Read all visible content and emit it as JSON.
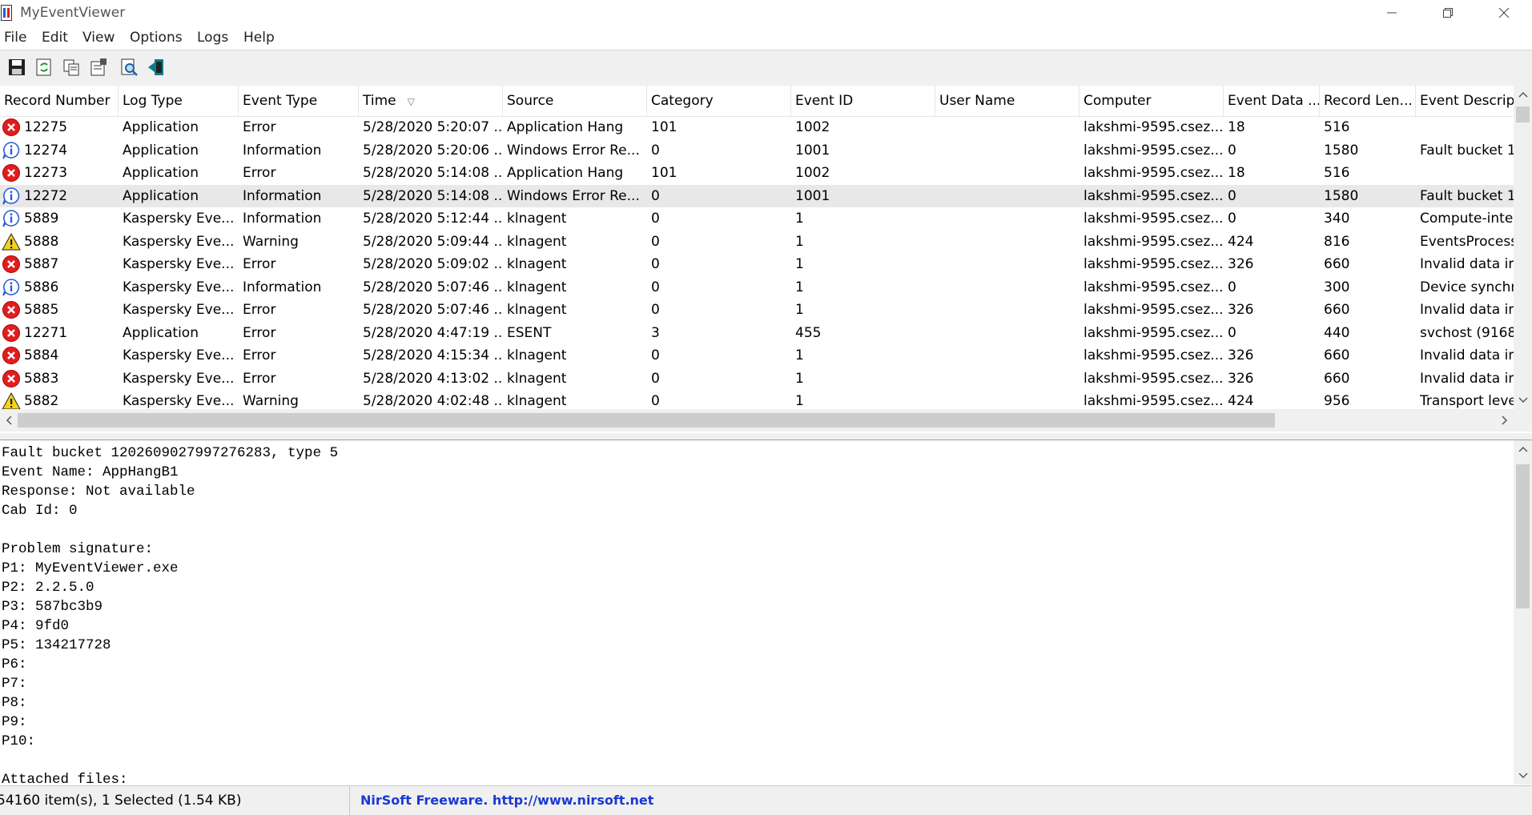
{
  "window": {
    "title": "MyEventViewer",
    "controls": {
      "minimize": "—",
      "maximize": "❐",
      "close": "✕"
    }
  },
  "menu": [
    "File",
    "Edit",
    "View",
    "Options",
    "Logs",
    "Help"
  ],
  "toolbar": {
    "buttons": [
      "save-icon",
      "refresh-icon",
      "copy-icon",
      "properties-icon",
      "find-icon",
      "exit-icon"
    ]
  },
  "list": {
    "columns": [
      "Record Number",
      "Log Type",
      "Event Type",
      "Time",
      "Source",
      "Category",
      "Event ID",
      "User Name",
      "Computer",
      "Event Data ...",
      "Record Len...",
      "Event Descript"
    ],
    "sort_indicator": "▽",
    "rows": [
      {
        "icon": "error",
        "cells": [
          "12275",
          "Application",
          "Error",
          "5/28/2020 5:20:07 ...",
          "Application Hang",
          "101",
          "1002",
          "",
          "lakshmi-9595.csez....",
          "18",
          "516",
          ""
        ]
      },
      {
        "icon": "info",
        "cells": [
          "12274",
          "Application",
          "Information",
          "5/28/2020 5:20:06 ...",
          "Windows Error Re...",
          "0",
          "1001",
          "",
          "lakshmi-9595.csez....",
          "0",
          "1580",
          "Fault bucket 1."
        ]
      },
      {
        "icon": "error",
        "cells": [
          "12273",
          "Application",
          "Error",
          "5/28/2020 5:14:08 ...",
          "Application Hang",
          "101",
          "1002",
          "",
          "lakshmi-9595.csez....",
          "18",
          "516",
          ""
        ]
      },
      {
        "icon": "info",
        "selected": true,
        "cells": [
          "12272",
          "Application",
          "Information",
          "5/28/2020 5:14:08 ...",
          "Windows Error Re...",
          "0",
          "1001",
          "",
          "lakshmi-9595.csez....",
          "0",
          "1580",
          "Fault bucket 1."
        ]
      },
      {
        "icon": "info",
        "cells": [
          "5889",
          "Kaspersky Eve...",
          "Information",
          "5/28/2020 5:12:44 ...",
          "klnagent",
          "0",
          "1",
          "",
          "lakshmi-9595.csez....",
          "0",
          "340",
          "Compute-inte"
        ]
      },
      {
        "icon": "warning",
        "cells": [
          "5888",
          "Kaspersky Eve...",
          "Warning",
          "5/28/2020 5:09:44 ...",
          "klnagent",
          "0",
          "1",
          "",
          "lakshmi-9595.csez....",
          "424",
          "816",
          "EventsProcess"
        ]
      },
      {
        "icon": "error",
        "cells": [
          "5887",
          "Kaspersky Eve...",
          "Error",
          "5/28/2020 5:09:02 ...",
          "klnagent",
          "0",
          "1",
          "",
          "lakshmi-9595.csez....",
          "326",
          "660",
          "Invalid data in"
        ]
      },
      {
        "icon": "info",
        "cells": [
          "5886",
          "Kaspersky Eve...",
          "Information",
          "5/28/2020 5:07:46 ...",
          "klnagent",
          "0",
          "1",
          "",
          "lakshmi-9595.csez....",
          "0",
          "300",
          "Device synchr"
        ]
      },
      {
        "icon": "error",
        "cells": [
          "5885",
          "Kaspersky Eve...",
          "Error",
          "5/28/2020 5:07:46 ...",
          "klnagent",
          "0",
          "1",
          "",
          "lakshmi-9595.csez....",
          "326",
          "660",
          "Invalid data in"
        ]
      },
      {
        "icon": "error",
        "cells": [
          "12271",
          "Application",
          "Error",
          "5/28/2020 4:47:19 ...",
          "ESENT",
          "3",
          "455",
          "",
          "lakshmi-9595.csez....",
          "0",
          "440",
          "svchost (9168,"
        ]
      },
      {
        "icon": "error",
        "cells": [
          "5884",
          "Kaspersky Eve...",
          "Error",
          "5/28/2020 4:15:34 ...",
          "klnagent",
          "0",
          "1",
          "",
          "lakshmi-9595.csez....",
          "326",
          "660",
          "Invalid data in"
        ]
      },
      {
        "icon": "error",
        "cells": [
          "5883",
          "Kaspersky Eve...",
          "Error",
          "5/28/2020 4:13:02 ...",
          "klnagent",
          "0",
          "1",
          "",
          "lakshmi-9595.csez....",
          "326",
          "660",
          "Invalid data in"
        ]
      },
      {
        "icon": "warning",
        "cells": [
          "5882",
          "Kaspersky Eve...",
          "Warning",
          "5/28/2020 4:02:48 ...",
          "klnagent",
          "0",
          "1",
          "",
          "lakshmi-9595.csez....",
          "424",
          "956",
          "Transport level"
        ]
      }
    ]
  },
  "details": {
    "lines": [
      "Fault bucket 1202609027997276283, type 5",
      "Event Name: AppHangB1",
      "Response: Not available",
      "Cab Id: 0",
      "",
      "Problem signature:",
      "P1: MyEventViewer.exe",
      "P2: 2.2.5.0",
      "P3: 587bc3b9",
      "P4: 9fd0",
      "P5: 134217728",
      "P6:",
      "P7:",
      "P8:",
      "P9:",
      "P10:",
      "",
      "Attached files:"
    ]
  },
  "status": {
    "count": "54160 item(s), 1 Selected  (1.54 KB)",
    "link": "NirSoft Freeware.  http://www.nirsoft.net"
  },
  "colors": {
    "error": "#e11d1d",
    "warning": "#f4d21a",
    "info": "#2a5bd7",
    "link": "#1a3ad1",
    "selected_row": "#e8e8e8"
  }
}
